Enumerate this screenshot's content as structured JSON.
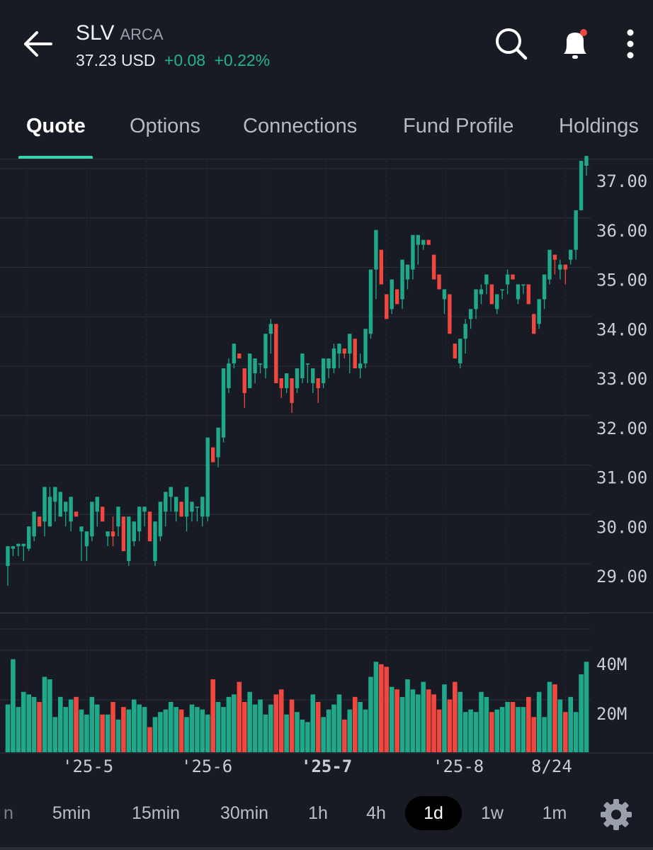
{
  "header": {
    "symbol": "SLV",
    "exchange": "ARCA",
    "price": "37.23 USD",
    "change": "+0.08",
    "change_pct": "+0.22%",
    "icons": [
      "back-arrow-icon",
      "search-icon",
      "bell-notification-icon",
      "more-vertical-icon"
    ],
    "change_color": "#21b58f"
  },
  "tabs": [
    {
      "label": "Quote",
      "active": true
    },
    {
      "label": "Options",
      "active": false
    },
    {
      "label": "Connections",
      "active": false
    },
    {
      "label": "Fund Profile",
      "active": false
    },
    {
      "label": "Holdings",
      "active": false
    }
  ],
  "chart_data": {
    "type": "candlestick",
    "price_axis": {
      "ticks": [
        "37.00",
        "36.00",
        "35.00",
        "34.00",
        "33.00",
        "32.00",
        "31.00",
        "30.00",
        "29.00"
      ],
      "range": [
        28.5,
        37.5
      ]
    },
    "volume_axis": {
      "ticks": [
        "40M",
        "20M"
      ],
      "range": [
        0,
        50
      ]
    },
    "x_labels": [
      "'25-5",
      "'25-6",
      "'25-7",
      "'25-8",
      "8/24"
    ],
    "up_color": "#1fa889",
    "down_color": "#f0473f",
    "candles": [
      [
        29.2,
        29.6,
        29.2,
        28.8,
        19
      ],
      [
        29.55,
        29.6,
        29.5,
        29.4,
        37
      ],
      [
        29.6,
        29.65,
        29.55,
        29.4,
        18
      ],
      [
        29.6,
        29.65,
        29.45,
        29.3,
        24
      ],
      [
        29.55,
        30.0,
        29.8,
        29.5,
        23
      ],
      [
        29.8,
        30.3,
        30.0,
        29.7,
        22
      ],
      [
        30.2,
        30.0,
        29.5,
        30.1,
        20
      ],
      [
        30.1,
        30.8,
        30.0,
        29.8,
        30
      ],
      [
        30.0,
        30.6,
        30.8,
        30.0,
        29
      ],
      [
        30.5,
        30.8,
        30.2,
        30.1,
        14
      ],
      [
        30.2,
        30.7,
        30.3,
        30.2,
        22
      ],
      [
        30.3,
        30.5,
        30.1,
        30.0,
        18
      ],
      [
        30.1,
        30.6,
        30.4,
        29.9,
        21
      ],
      [
        30.3,
        30.2,
        29.9,
        30.4,
        22
      ],
      [
        29.9,
        30.0,
        29.6,
        29.3,
        17
      ],
      [
        29.6,
        29.9,
        29.5,
        29.3,
        15
      ],
      [
        29.8,
        30.5,
        30.2,
        29.7,
        22
      ],
      [
        30.3,
        30.6,
        30.4,
        30.0,
        19
      ],
      [
        30.4,
        30.1,
        29.7,
        30.4,
        15
      ],
      [
        29.8,
        29.9,
        29.6,
        29.6,
        15
      ],
      [
        29.9,
        29.8,
        30.2,
        29.6,
        20
      ],
      [
        30.0,
        30.4,
        30.3,
        29.8,
        13
      ],
      [
        30.2,
        29.5,
        29.3,
        30.4,
        18
      ],
      [
        29.3,
        30.2,
        29.9,
        29.2,
        17
      ],
      [
        29.7,
        30.1,
        29.9,
        29.6,
        21
      ],
      [
        29.9,
        30.4,
        30.2,
        29.7,
        19
      ],
      [
        30.3,
        30.4,
        30.0,
        30.0,
        18
      ],
      [
        30.3,
        29.7,
        29.2,
        30.2,
        10
      ],
      [
        29.3,
        30.1,
        29.8,
        29.2,
        14
      ],
      [
        29.8,
        30.5,
        30.2,
        29.7,
        16
      ],
      [
        30.3,
        30.7,
        30.5,
        30.0,
        17
      ],
      [
        30.6,
        30.8,
        30.4,
        30.3,
        20
      ],
      [
        30.3,
        30.6,
        30.5,
        30.1,
        18
      ],
      [
        30.5,
        30.2,
        29.9,
        30.6,
        17
      ],
      [
        30.2,
        30.8,
        30.3,
        29.9,
        14
      ],
      [
        30.3,
        30.5,
        30.4,
        30.1,
        19
      ],
      [
        30.4,
        30.4,
        30.1,
        30.1,
        18
      ],
      [
        30.2,
        30.6,
        30.5,
        30.0,
        17
      ],
      [
        30.2,
        31.8,
        31.6,
        30.1,
        15
      ],
      [
        31.6,
        31.3,
        31.3,
        31.8,
        29
      ],
      [
        31.4,
        32.0,
        31.8,
        31.2,
        20
      ],
      [
        31.8,
        33.2,
        32.9,
        31.7,
        18
      ],
      [
        32.8,
        33.3,
        33.4,
        32.7,
        22
      ],
      [
        33.3,
        33.7,
        33.6,
        33.2,
        23
      ],
      [
        33.5,
        33.4,
        33.1,
        33.7,
        28
      ],
      [
        33.2,
        32.7,
        32.8,
        32.4,
        20
      ],
      [
        32.8,
        33.5,
        33.1,
        33.2,
        24
      ],
      [
        33.1,
        33.4,
        33.3,
        32.9,
        19
      ],
      [
        33.3,
        33.3,
        33.2,
        33.1,
        21
      ],
      [
        33.2,
        33.9,
        33.9,
        33.0,
        15
      ],
      [
        33.9,
        34.1,
        34.2,
        33.5,
        19
      ],
      [
        34.1,
        32.9,
        32.8,
        34.1,
        23
      ],
      [
        33.0,
        32.8,
        32.7,
        32.6,
        25
      ],
      [
        32.8,
        33.1,
        33.0,
        32.7,
        15
      ],
      [
        33.0,
        32.5,
        32.7,
        32.3,
        21
      ],
      [
        32.8,
        33.2,
        33.0,
        32.7,
        16
      ],
      [
        33.0,
        33.5,
        33.3,
        32.9,
        13
      ],
      [
        33.3,
        33.3,
        33.0,
        32.9,
        12
      ],
      [
        32.9,
        33.2,
        33.1,
        32.7,
        23
      ],
      [
        33.0,
        32.8,
        32.8,
        32.5,
        20
      ],
      [
        32.9,
        33.4,
        33.3,
        32.8,
        14
      ],
      [
        33.2,
        33.4,
        33.2,
        33.0,
        17
      ],
      [
        33.2,
        33.6,
        33.7,
        33.1,
        19
      ],
      [
        33.5,
        33.7,
        33.5,
        33.2,
        23
      ],
      [
        33.6,
        33.5,
        33.4,
        33.4,
        13
      ],
      [
        33.5,
        33.9,
        33.7,
        33.1,
        17
      ],
      [
        33.8,
        33.2,
        33.0,
        33.6,
        22
      ],
      [
        33.2,
        33.3,
        33.5,
        33.0,
        20
      ],
      [
        33.3,
        34.0,
        33.7,
        33.2,
        17
      ],
      [
        33.9,
        35.2,
        35.1,
        33.8,
        30
      ],
      [
        35.2,
        36.0,
        35.6,
        34.6,
        36
      ],
      [
        35.6,
        34.9,
        34.6,
        35.7,
        35
      ],
      [
        34.7,
        34.2,
        34.3,
        34.3,
        34
      ],
      [
        34.4,
        35.0,
        34.8,
        34.3,
        26
      ],
      [
        34.8,
        34.5,
        34.4,
        34.6,
        25
      ],
      [
        34.6,
        35.4,
        35.0,
        34.4,
        22
      ],
      [
        35.0,
        35.3,
        35.2,
        34.8,
        29
      ],
      [
        35.2,
        35.9,
        35.5,
        35.0,
        25
      ],
      [
        35.7,
        35.9,
        35.6,
        35.3,
        23
      ],
      [
        35.7,
        35.8,
        35.7,
        35.6,
        28
      ],
      [
        35.8,
        35.7,
        35.5,
        35.7,
        25
      ],
      [
        35.5,
        35.0,
        34.9,
        35.5,
        23
      ],
      [
        35.1,
        34.8,
        34.5,
        35.1,
        17
      ],
      [
        34.6,
        34.8,
        34.5,
        34.3,
        27
      ],
      [
        34.7,
        33.9,
        33.5,
        34.7,
        21
      ],
      [
        33.7,
        33.4,
        33.3,
        33.8,
        28
      ],
      [
        33.3,
        33.8,
        33.8,
        33.2,
        24
      ],
      [
        33.8,
        34.1,
        34.2,
        33.5,
        16
      ],
      [
        34.2,
        34.4,
        34.3,
        34.0,
        17
      ],
      [
        34.4,
        34.8,
        34.7,
        34.2,
        16
      ],
      [
        34.7,
        34.8,
        34.9,
        34.5,
        24
      ],
      [
        34.9,
        35.1,
        35.0,
        34.7,
        22
      ],
      [
        34.9,
        34.5,
        34.3,
        35.0,
        16
      ],
      [
        34.4,
        34.7,
        34.7,
        34.3,
        17
      ],
      [
        34.8,
        34.8,
        34.8,
        34.6,
        18
      ],
      [
        34.9,
        35.1,
        35.2,
        34.7,
        20
      ],
      [
        35.1,
        35.0,
        34.6,
        35.2,
        20
      ],
      [
        34.6,
        34.9,
        34.8,
        34.5,
        18
      ],
      [
        34.9,
        34.9,
        34.8,
        34.7,
        18
      ],
      [
        34.9,
        34.5,
        34.2,
        34.9,
        22
      ],
      [
        34.3,
        33.9,
        33.9,
        34.4,
        14
      ],
      [
        34.1,
        34.6,
        34.5,
        34.0,
        24
      ],
      [
        34.6,
        35.1,
        35.0,
        34.4,
        14
      ],
      [
        35.0,
        35.6,
        35.5,
        34.9,
        28
      ],
      [
        35.5,
        35.4,
        35.2,
        35.1,
        27
      ],
      [
        35.2,
        35.3,
        35.4,
        35.0,
        21
      ],
      [
        35.3,
        35.2,
        35.1,
        34.9,
        16
      ],
      [
        35.4,
        35.6,
        35.6,
        35.3,
        22
      ],
      [
        35.6,
        36.4,
        36.3,
        35.4,
        16
      ],
      [
        36.4,
        37.4,
        37.3,
        36.8,
        31
      ],
      [
        37.3,
        37.5,
        37.4,
        37.1,
        36
      ]
    ]
  },
  "intervals": {
    "items": [
      {
        "label": "n",
        "active": false
      },
      {
        "label": "5min",
        "active": false
      },
      {
        "label": "15min",
        "active": false
      },
      {
        "label": "30min",
        "active": false
      },
      {
        "label": "1h",
        "active": false
      },
      {
        "label": "4h",
        "active": false
      },
      {
        "label": "1d",
        "active": true
      },
      {
        "label": "1w",
        "active": false
      },
      {
        "label": "1m",
        "active": false
      }
    ],
    "settings_icon": "gear-icon"
  }
}
